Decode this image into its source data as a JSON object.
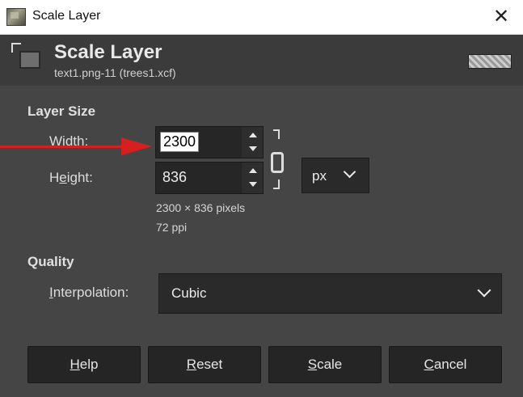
{
  "window": {
    "title": "Scale Layer",
    "close_glyph": "✕"
  },
  "header": {
    "title": "Scale Layer",
    "subtitle": "text1.png-11 (trees1.xcf)"
  },
  "layer_size": {
    "section_title": "Layer Size",
    "width": {
      "label_pre": "",
      "label_mnemonic": "W",
      "label_post": "idth:",
      "value": "2300"
    },
    "height": {
      "label_pre": "H",
      "label_mnemonic": "e",
      "label_post": "ight:",
      "value": "836"
    },
    "unit": "px",
    "pixels_info": "2300 × 836 pixels",
    "ppi_info": "72 ppi"
  },
  "quality": {
    "section_title": "Quality",
    "interpolation_label_mnemonic": "I",
    "interpolation_label_rest": "nterpolation:",
    "interpolation_value": "Cubic"
  },
  "buttons": [
    {
      "mnemonic": "H",
      "rest": "elp"
    },
    {
      "mnemonic": "R",
      "rest": "eset"
    },
    {
      "mnemonic": "S",
      "rest": "cale"
    },
    {
      "mnemonic": "C",
      "rest": "ancel"
    }
  ],
  "colors": {
    "dialog_bg": "#454545",
    "header_bg": "#3b3b3b",
    "field_bg": "#262626",
    "annotation_arrow": "#d62020"
  }
}
